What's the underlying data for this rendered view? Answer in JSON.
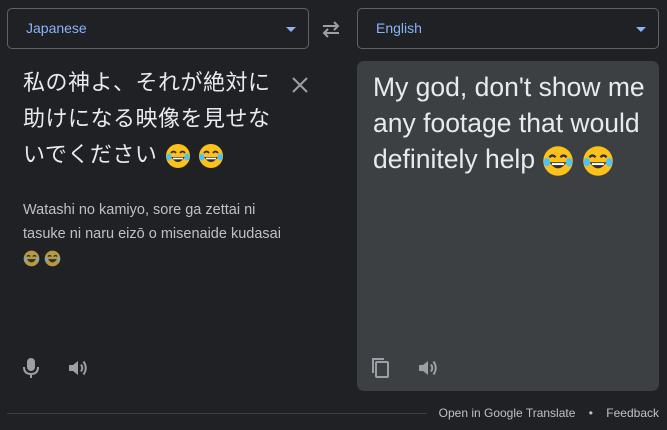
{
  "source_language": {
    "label": "Japanese"
  },
  "target_language": {
    "label": "English"
  },
  "source": {
    "text": "私の神よ、それが絶対に助けになる映像を見せないでください",
    "romanization": "Watashi no kamiyo, sore ga zettai ni tasuke ni naru eizō o misenaide kudasai"
  },
  "target": {
    "text": "My god, don't show me any footage that would definitely help"
  },
  "footer": {
    "open_link": "Open in Google Translate",
    "separator": "•",
    "feedback_link": "Feedback"
  },
  "icons": {
    "swap": "swap-icon",
    "clear": "close-icon",
    "mic": "microphone-icon",
    "speaker": "speaker-icon",
    "copy": "copy-icon",
    "emoji": "face-with-tears-of-joy-emoji"
  },
  "colors": {
    "background": "#202124",
    "panel": "#3c4043",
    "accent": "#8ab4f8",
    "text_primary": "#e8eaed",
    "text_secondary": "#bdc1c6",
    "icon": "#9aa0a6"
  }
}
